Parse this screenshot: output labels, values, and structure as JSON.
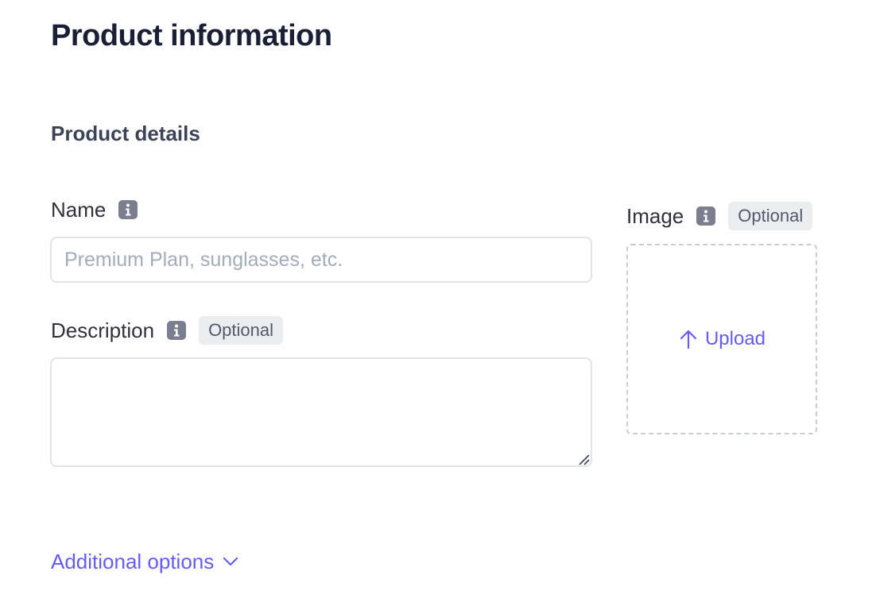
{
  "page": {
    "title": "Product information"
  },
  "section": {
    "title": "Product details"
  },
  "fields": {
    "name": {
      "label": "Name",
      "value": "",
      "placeholder": "Premium Plan, sunglasses, etc."
    },
    "description": {
      "label": "Description",
      "badge": "Optional",
      "value": ""
    },
    "image": {
      "label": "Image",
      "badge": "Optional",
      "upload_label": "Upload"
    }
  },
  "additional_options": {
    "label": "Additional options"
  },
  "icons": {
    "info": "info-icon",
    "upload": "arrow-up-icon",
    "expand": "chevron-down-icon"
  },
  "colors": {
    "accent": "#635bff",
    "heading": "#1a1f36",
    "badge_bg": "#ebeef1",
    "info_icon": "#7a7e8f"
  }
}
